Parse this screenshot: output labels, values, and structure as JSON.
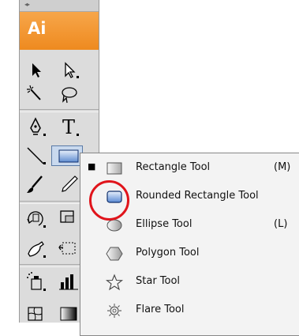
{
  "app": {
    "logo_text": "Ai",
    "grip_text": "◂▸"
  },
  "toolbox": {
    "tools": [
      "selection-tool",
      "direct-selection-tool",
      "magic-wand-tool",
      "lasso-tool",
      "pen-tool",
      "type-tool",
      "line-segment-tool",
      "rectangle-tool",
      "paintbrush-tool",
      "pencil-tool",
      "rotate-tool",
      "scale-tool",
      "warp-tool",
      "free-transform-tool",
      "symbol-sprayer-tool",
      "column-graph-tool",
      "mesh-tool",
      "gradient-tool"
    ],
    "type_glyph": "T"
  },
  "flyout": {
    "items": [
      {
        "label": "Rectangle Tool",
        "shortcut": "(M)",
        "checked": true,
        "icon": "rectangle-icon"
      },
      {
        "label": "Rounded Rectangle Tool",
        "shortcut": "",
        "checked": false,
        "icon": "rounded-rectangle-icon"
      },
      {
        "label": "Ellipse Tool",
        "shortcut": "(L)",
        "checked": false,
        "icon": "ellipse-icon"
      },
      {
        "label": "Polygon Tool",
        "shortcut": "",
        "checked": false,
        "icon": "polygon-icon"
      },
      {
        "label": "Star Tool",
        "shortcut": "",
        "checked": false,
        "icon": "star-icon"
      },
      {
        "label": "Flare Tool",
        "shortcut": "",
        "checked": false,
        "icon": "flare-icon"
      }
    ],
    "check_glyph": "■"
  },
  "highlight": {
    "color": "#e0141b",
    "target": "rounded-rectangle-icon"
  },
  "colors": {
    "brand": "#ee8a1f",
    "selected_bg": "#c9d9ee"
  }
}
